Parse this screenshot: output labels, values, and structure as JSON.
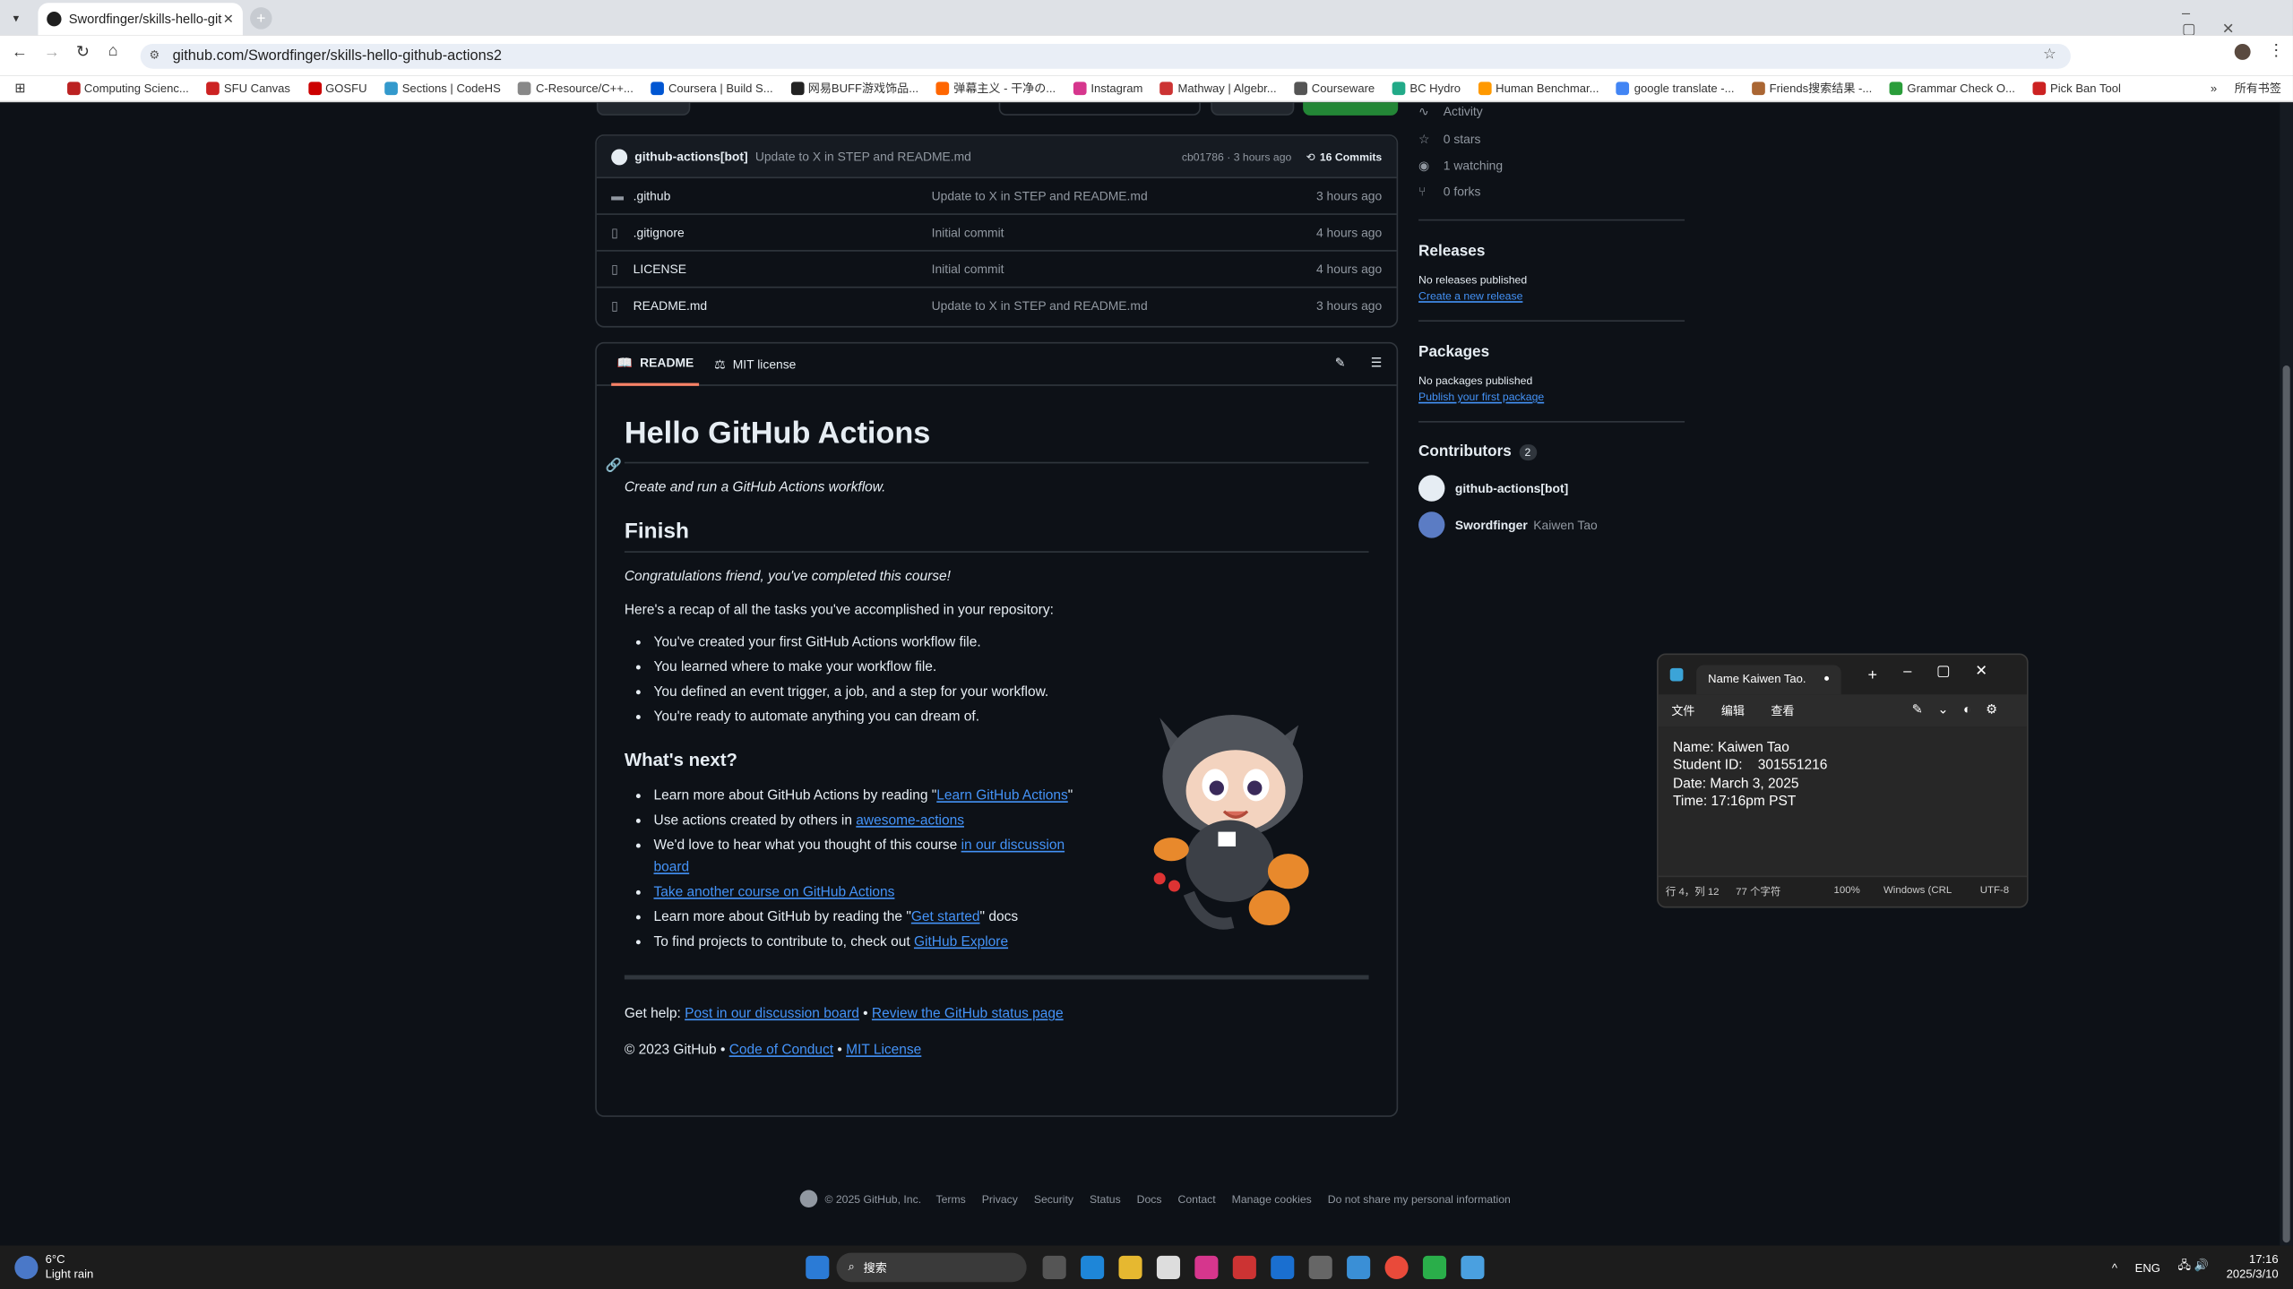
{
  "browser": {
    "tab_title": "Swordfinger/skills-hello-gith",
    "url": "github.com/Swordfinger/skills-hello-github-actions2",
    "bookmarks": [
      "Computing Scienc...",
      "SFU Canvas",
      "GOSFU",
      "Sections | CodeHS",
      "C-Resource/C++...",
      "Coursera | Build S...",
      "网易BUFF游戏饰品...",
      "弹幕主义 - 干净の...",
      "Instagram",
      "Mathway | Algebr...",
      "Courseware",
      "BC Hydro",
      "Human Benchmar...",
      "google translate -...",
      "Friends搜索结果 -...",
      "Grammar Check O...",
      "Pick Ban Tool"
    ],
    "all_bookmarks": "所有书签"
  },
  "commit_bar": {
    "author": "github-actions[bot]",
    "message": "Update to X in STEP and README.md",
    "hash_time": "cb01786 · 3 hours ago",
    "commits": "16 Commits"
  },
  "files": [
    {
      "name": ".github",
      "type": "folder",
      "msg": "Update to X in STEP and README.md",
      "time": "3 hours ago"
    },
    {
      "name": ".gitignore",
      "type": "file",
      "msg": "Initial commit",
      "time": "4 hours ago"
    },
    {
      "name": "LICENSE",
      "type": "file",
      "msg": "Initial commit",
      "time": "4 hours ago"
    },
    {
      "name": "README.md",
      "type": "file",
      "msg": "Update to X in STEP and README.md",
      "time": "3 hours ago"
    }
  ],
  "readme": {
    "tab1": "README",
    "tab2": "MIT license",
    "h1": "Hello GitHub Actions",
    "subtitle": "Create and run a GitHub Actions workflow.",
    "h2_finish": "Finish",
    "congrats": "Congratulations friend, you've completed this course!",
    "recap": "Here's a recap of all the tasks you've accomplished in your repository:",
    "tasks": [
      "You've created your first GitHub Actions workflow file.",
      "You learned where to make your workflow file.",
      "You defined an event trigger, a job, and a step for your workflow.",
      "You're ready to automate anything you can dream of."
    ],
    "h2_next": "What's next?",
    "next1_pre": "Learn more about GitHub Actions by reading \"",
    "next1_link": "Learn GitHub Actions",
    "next1_post": "\"",
    "next2_pre": "Use actions created by others in ",
    "next2_link": "awesome-actions",
    "next3_pre": "We'd love to hear what you thought of this course ",
    "next3_link": "in our discussion board",
    "next4_link": "Take another course on GitHub Actions",
    "next5_pre": "Learn more about GitHub by reading the \"",
    "next5_link": "Get started",
    "next5_post": "\" docs",
    "next6_pre": "To find projects to contribute to, check out ",
    "next6_link": "GitHub Explore",
    "help_pre": "Get help: ",
    "help_link1": "Post in our discussion board",
    "help_sep": " • ",
    "help_link2": "Review the GitHub status page",
    "copy_pre": "© 2023 GitHub • ",
    "copy_link1": "Code of Conduct",
    "copy_sep": " • ",
    "copy_link2": "MIT License"
  },
  "sidebar": {
    "activity": "Activity",
    "stars": "0 stars",
    "watching": "1 watching",
    "forks": "0 forks",
    "releases_h": "Releases",
    "releases_none": "No releases published",
    "releases_link": "Create a new release",
    "packages_h": "Packages",
    "packages_none": "No packages published",
    "packages_link": "Publish your first package",
    "contributors_h": "Contributors",
    "contributors_count": "2",
    "c1": "github-actions[bot]",
    "c2": "Swordfinger",
    "c2_name": "Kaiwen Tao"
  },
  "footer": {
    "copy": "© 2025 GitHub, Inc.",
    "links": [
      "Terms",
      "Privacy",
      "Security",
      "Status",
      "Docs",
      "Contact",
      "Manage cookies",
      "Do not share my personal information"
    ]
  },
  "notepad": {
    "tab": "Name Kaiwen Tao.",
    "menu": [
      "文件",
      "编辑",
      "查看"
    ],
    "lines": [
      "Name: Kaiwen Tao",
      "Student ID:    301551216",
      "Date: March 3, 2025",
      "Time: 17:16pm PST"
    ],
    "status_pos": "行 4，列 12",
    "status_chars": "77 个字符",
    "zoom": "100%",
    "eol": "Windows (CRL",
    "enc": "UTF-8"
  },
  "taskbar": {
    "temp": "6°C",
    "weather": "Light rain",
    "search": "搜索",
    "lang": "ENG",
    "time": "17:16",
    "date": "2025/3/10"
  },
  "colors": {
    "accent": "#4493f8",
    "bg": "#0d1117",
    "border": "#30363d",
    "green": "#238636"
  }
}
